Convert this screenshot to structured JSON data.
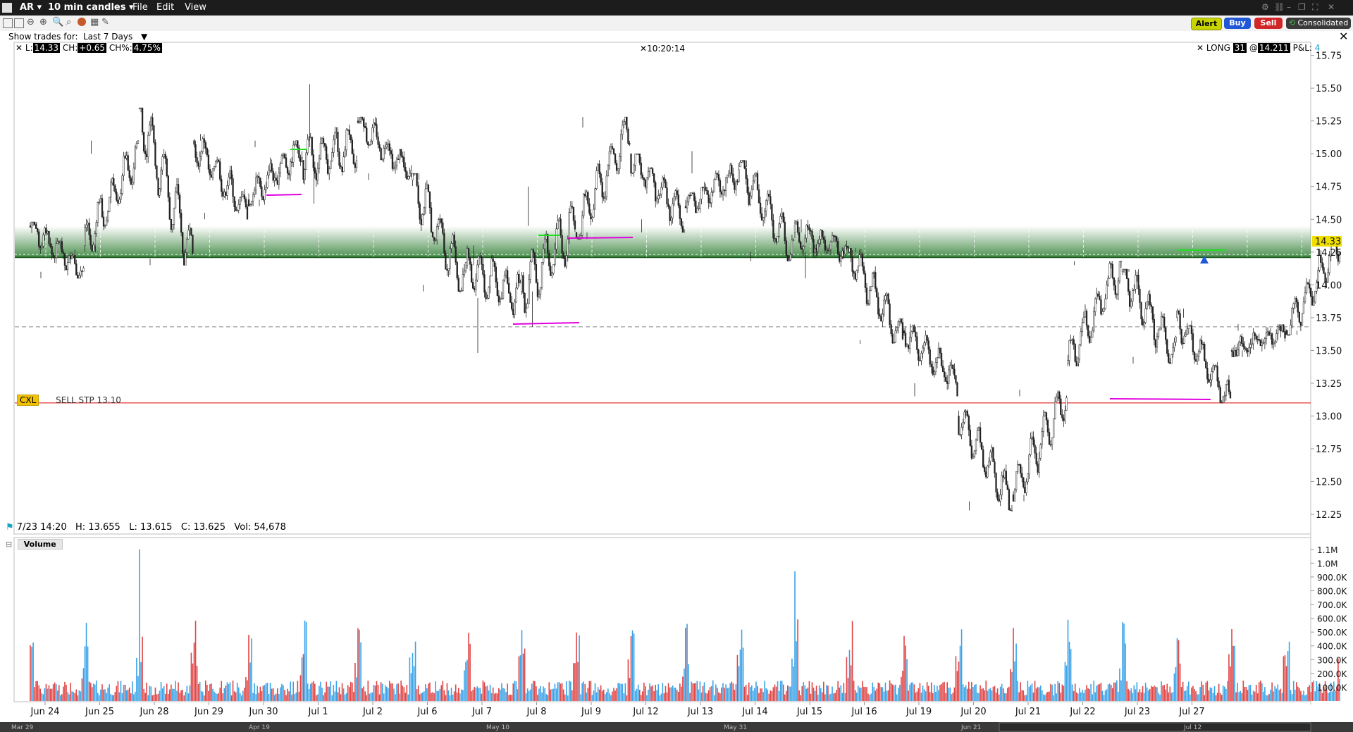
{
  "window": {
    "symbol": "AR",
    "interval": "10 min candles",
    "menu": [
      "File",
      "Edit",
      "View"
    ]
  },
  "toolbar": {
    "show_trades_label": "Show trades for:",
    "show_trades_value": "Last 7 Days",
    "alert_label": "Alert",
    "buy_label": "Buy",
    "sell_label": "Sell",
    "consolidated_label": "Consolidated"
  },
  "header": {
    "last_label": "L:",
    "last_value": "14.33",
    "change_label": "CH:",
    "change_value": "+0.65",
    "change_pct_label": "CH%:",
    "change_pct_value": "4.75%",
    "time": "10:20:14",
    "position_label": "LONG",
    "position_qty": "31",
    "position_at": "@",
    "position_price": "14.211",
    "pnl_label": "P&L:",
    "pnl_value": "4"
  },
  "orders": {
    "cxl_label": "CXL",
    "order_text": "SELL STP 13.10"
  },
  "info_bar": {
    "date": "7/23 14:20",
    "high_label": "H:",
    "high": "13.655",
    "low_label": "L:",
    "low": "13.615",
    "close_label": "C:",
    "close": "13.625",
    "vol_label": "Vol:",
    "vol": "54,678"
  },
  "volume_panel": {
    "title": "Volume"
  },
  "navigator": {
    "labels": [
      "Mar 29",
      "Apr 19",
      "May 10",
      "May 31",
      "Jun 21",
      "Jul 12"
    ]
  },
  "colors": {
    "up": "#3aa3e8",
    "down": "#e04545",
    "zone": "#2e7d32",
    "stop_line": "#e53935",
    "target_line": "#e000e0"
  },
  "chart_data": {
    "type": "candlestick",
    "price_axis_ticks": [
      "15.75",
      "15.50",
      "15.25",
      "15.00",
      "14.75",
      "14.50",
      "14.25",
      "14.00",
      "13.75",
      "13.50",
      "13.25",
      "13.00",
      "12.75",
      "12.50",
      "12.25"
    ],
    "ylim": [
      12.1,
      15.85
    ],
    "x_ticks": [
      "Jun 24",
      "Jun 25",
      "Jun 28",
      "Jun 29",
      "Jun 30",
      "Jul 1",
      "Jul 2",
      "Jul 6",
      "Jul 7",
      "Jul 8",
      "Jul 9",
      "Jul 12",
      "Jul 13",
      "Jul 14",
      "Jul 15",
      "Jul 16",
      "Jul 19",
      "Jul 20",
      "Jul 21",
      "Jul 22",
      "Jul 23",
      "Jul 27"
    ],
    "last_price": 14.33,
    "stop_price": 13.1,
    "avg_cost": 14.211,
    "dashed_level": 13.68,
    "zone": [
      14.21,
      14.45
    ],
    "volume_ticks": [
      "1.1M",
      "1.0M",
      "900.0K",
      "800.0K",
      "700.0K",
      "600.0K",
      "500.0K",
      "400.0K",
      "300.0K",
      "200.0K",
      "100.0K"
    ],
    "path": [
      {
        "day": 0,
        "o": 14.45,
        "c": 14.1,
        "lo": 14.05,
        "hi": 14.48
      },
      {
        "day": 1,
        "o": 14.3,
        "c": 15.0,
        "lo": 14.25,
        "hi": 15.1
      },
      {
        "day": 2,
        "o": 15.35,
        "c": 14.2,
        "lo": 14.15,
        "hi": 15.35
      },
      {
        "day": 3,
        "o": 15.1,
        "c": 14.55,
        "lo": 14.5,
        "hi": 15.15
      },
      {
        "day": 4,
        "o": 14.65,
        "c": 15.05,
        "lo": 14.6,
        "hi": 15.1
      },
      {
        "day": 5,
        "o": 14.95,
        "c": 15.05,
        "lo": 14.62,
        "hi": 15.53
      },
      {
        "day": 6,
        "o": 15.25,
        "c": 14.85,
        "lo": 14.8,
        "hi": 15.28
      },
      {
        "day": 7,
        "o": 14.8,
        "c": 14.0,
        "lo": 13.95,
        "hi": 14.85
      },
      {
        "day": 8,
        "o": 14.15,
        "c": 13.9,
        "lo": 13.48,
        "hi": 14.3
      },
      {
        "day": 9,
        "o": 13.95,
        "c": 14.45,
        "lo": 13.68,
        "hi": 14.75
      },
      {
        "day": 10,
        "o": 14.4,
        "c": 15.2,
        "lo": 14.35,
        "hi": 15.28
      },
      {
        "day": 11,
        "o": 15.0,
        "c": 14.5,
        "lo": 14.4,
        "hi": 15.0
      },
      {
        "day": 12,
        "o": 14.6,
        "c": 14.85,
        "lo": 14.55,
        "hi": 15.02
      },
      {
        "day": 13,
        "o": 14.9,
        "c": 14.25,
        "lo": 14.18,
        "hi": 14.95
      },
      {
        "day": 14,
        "o": 14.4,
        "c": 14.25,
        "lo": 14.05,
        "hi": 14.5
      },
      {
        "day": 15,
        "o": 14.25,
        "c": 13.58,
        "lo": 13.55,
        "hi": 14.28
      },
      {
        "day": 16,
        "o": 13.65,
        "c": 13.25,
        "lo": 13.15,
        "hi": 13.7
      },
      {
        "day": 17,
        "o": 13.0,
        "c": 12.35,
        "lo": 12.28,
        "hi": 13.05
      },
      {
        "day": 18,
        "o": 12.4,
        "c": 13.15,
        "lo": 12.35,
        "hi": 13.2
      },
      {
        "day": 19,
        "o": 13.4,
        "c": 14.15,
        "lo": 13.38,
        "hi": 14.18
      },
      {
        "day": 20,
        "o": 14.1,
        "c": 13.45,
        "lo": 13.4,
        "hi": 14.12
      },
      {
        "day": 21,
        "o": 13.75,
        "c": 13.1,
        "lo": 13.1,
        "hi": 13.82
      },
      {
        "day": 22,
        "o": 13.5,
        "c": 13.65,
        "lo": 13.45,
        "hi": 13.7
      },
      {
        "day": 23,
        "o": 13.65,
        "c": 14.33,
        "lo": 13.62,
        "hi": 14.33
      }
    ]
  }
}
